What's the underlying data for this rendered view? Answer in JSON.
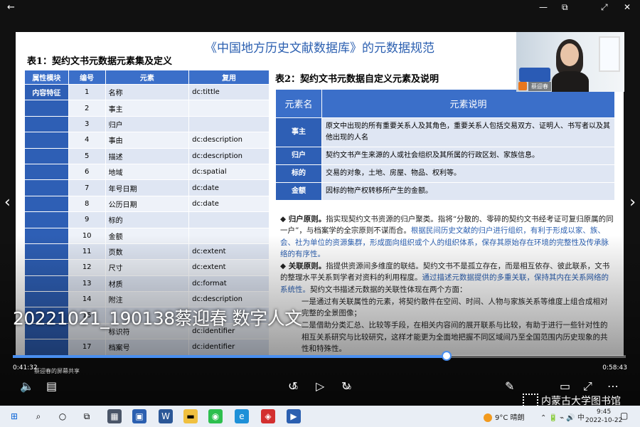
{
  "window": {
    "back_icon": "←",
    "minimize": "—",
    "restore": "⧉",
    "maximize": "⤢",
    "close": "✕"
  },
  "slide": {
    "title": "《中国地方历史文献数据库》的元数据规范",
    "table1": {
      "caption": "表1：契约文书元数据元素集及定义",
      "headers": [
        "属性模块",
        "编号",
        "元素",
        "复用"
      ],
      "rows": [
        {
          "module": "内容特征",
          "no": "1",
          "element": "名称",
          "reuse": "dc:tittle"
        },
        {
          "module": "",
          "no": "2",
          "element": "事主",
          "reuse": ""
        },
        {
          "module": "",
          "no": "3",
          "element": "归户",
          "reuse": ""
        },
        {
          "module": "",
          "no": "4",
          "element": "事由",
          "reuse": "dc:description"
        },
        {
          "module": "",
          "no": "5",
          "element": "描述",
          "reuse": "dc:description"
        },
        {
          "module": "",
          "no": "6",
          "element": "地域",
          "reuse": "dc:spatial"
        },
        {
          "module": "",
          "no": "7",
          "element": "年号日期",
          "reuse": "dc:date"
        },
        {
          "module": "",
          "no": "8",
          "element": "公历日期",
          "reuse": "dc:date"
        },
        {
          "module": "",
          "no": "9",
          "element": "标的",
          "reuse": ""
        },
        {
          "module": "",
          "no": "10",
          "element": "金额",
          "reuse": ""
        },
        {
          "module": "",
          "no": "11",
          "element": "页数",
          "reuse": "dc:extent"
        },
        {
          "module": "",
          "no": "12",
          "element": "尺寸",
          "reuse": "dc:extent"
        },
        {
          "module": "",
          "no": "13",
          "element": "材质",
          "reuse": "dc:format"
        },
        {
          "module": "",
          "no": "14",
          "element": "附注",
          "reuse": "dc:description"
        },
        {
          "module": "",
          "no": "15",
          "element": "",
          "reuse": ""
        },
        {
          "module": "",
          "no": "",
          "element": "标识符",
          "reuse": "dc:identifier"
        },
        {
          "module": "",
          "no": "17",
          "element": "档案号",
          "reuse": "dc:identifier"
        },
        {
          "module": "",
          "no": "18",
          "element": "语种",
          "reuse": "dc:language"
        }
      ]
    },
    "table2": {
      "caption": "表2：契约文书元数据自定义元素及说明",
      "headers": [
        "元素名",
        "元素说明"
      ],
      "rows": [
        {
          "name": "事主",
          "desc": "原文中出现的所有重要关系人及其角色，重要关系人包括交易双方、证明人、书写者以及其他出现的人名"
        },
        {
          "name": "归户",
          "desc": "契约文书产生来源的人或社会组织及其所属的行政区划、家族信息。"
        },
        {
          "name": "标的",
          "desc": "交易的对象，土地、房屋、物品、权利等。"
        },
        {
          "name": "金额",
          "desc": "因标的物产权转移所产生的金额。"
        }
      ]
    },
    "principles": {
      "p1_head": "◆  归户原则。",
      "p1_a": "指实现契约文书资源的归户聚类。指将“分散的、零碎的契约文书经考证可复归原属的同一户”，与档案学的全宗原则不谋而合。",
      "p1_b": "根据民间历史文献的归户进行组织，有利于形成以家、族、会、社为单位的资源集群，形成面向组织或个人的组织体系，保存其原始存在环境的完整性及传承脉络的有序性。",
      "p2_head": "◆  关联原则。",
      "p2_a": "指提供资源间多维度的联结。契约文书不是孤立存在，而是相互依存、彼此联系，文书的整理水平关系到学者对资料的利用程度。",
      "p2_b": "通过描述元数据提供的多重关联，保持其内在关系网络的系统性。",
      "p2_c": "契约文书描述元数据的关联性体现在两个方面：",
      "p2_d": "一是通过有关联属性的元素，将契约散件在空间、时间、人物与家族关系等维度上组合成相对完整的全景图像；",
      "p2_e": "二是借助分类汇总、比较等手段，在相关内容间的展开联系与比较，有助于进行一些针对性的相互关系研究与比较研究，这样才能更为全面地把握不同区域间乃至全国范围内历史现象的共性和特殊性。"
    }
  },
  "webcam": {
    "name": "蔡迎春"
  },
  "caption": "20221021_190138蔡迎春 数字人文",
  "player": {
    "elapsed": "0:41:32",
    "total": "0:58:43",
    "progress": 0.708,
    "watermark": "蔡迎春的屏幕共享",
    "skip_back": "10",
    "skip_fwd": "30",
    "logo_text": "内蒙古大学图书馆"
  },
  "taskbar": {
    "temp": "9°C",
    "weather": "晴朗",
    "time": "9:45",
    "date": "2022-10-22",
    "ime": "中"
  }
}
